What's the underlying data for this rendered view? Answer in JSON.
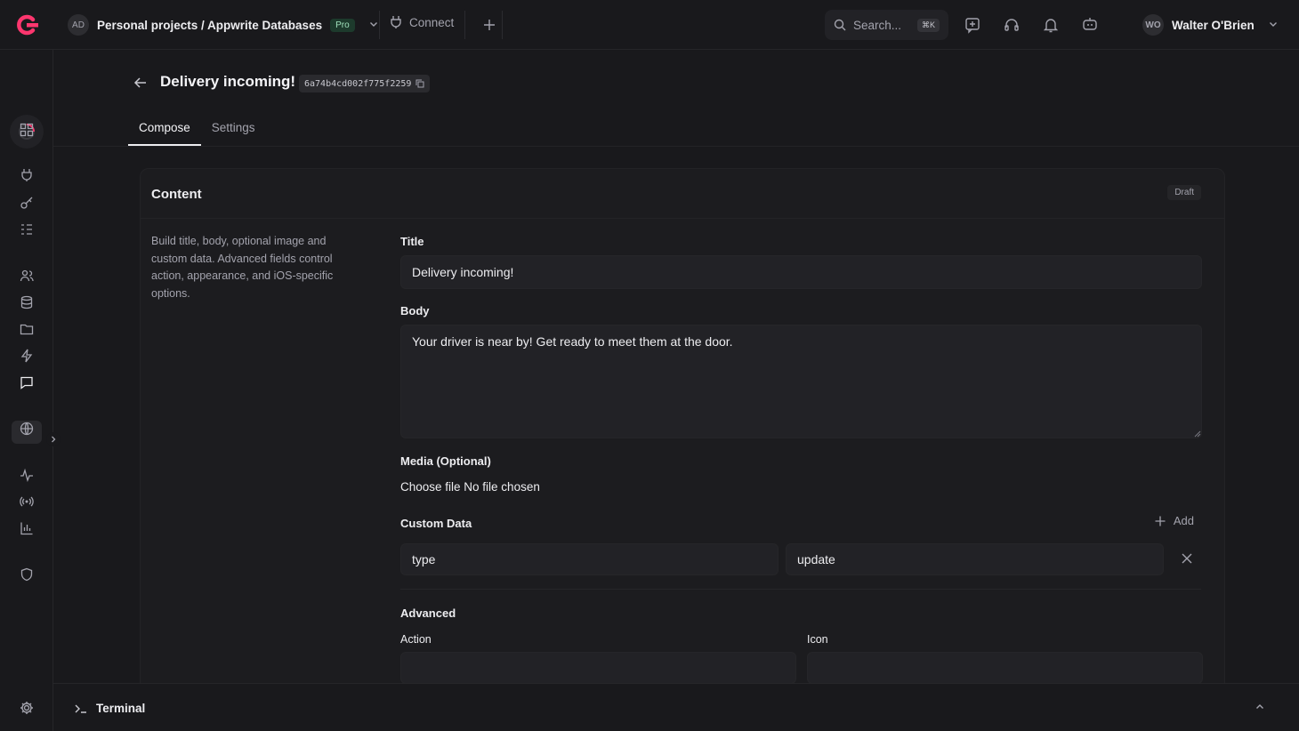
{
  "topbar": {
    "project_initials": "AD",
    "project_path": "Personal projects / Appwrite Databases",
    "plan_badge": "Pro",
    "connect_label": "Connect",
    "search_placeholder": "Search...",
    "search_shortcut": "⌘K",
    "user_initials": "WO",
    "user_name": "Walter O'Brien"
  },
  "page": {
    "title": "Delivery incoming!",
    "message_id": "6a74b4cd002f775f2259",
    "tabs": [
      {
        "label": "Compose",
        "active": true
      },
      {
        "label": "Settings",
        "active": false
      }
    ]
  },
  "card": {
    "title": "Content",
    "status_badge": "Draft",
    "description": "Build title, body, optional image and custom data. Advanced fields control action, appearance, and iOS-specific options.",
    "fields": {
      "title_label": "Title",
      "title_value": "Delivery incoming!",
      "body_label": "Body",
      "body_value": "Your driver is near by! Get ready to meet them at the door.",
      "media_label": "Media (Optional)",
      "media_file_text": "Choose file No file chosen",
      "custom_data_label": "Custom Data",
      "add_label": "Add",
      "custom_data": [
        {
          "key": "type",
          "value": "update"
        }
      ],
      "advanced_label": "Advanced",
      "action_label": "Action",
      "action_value": "",
      "icon_label": "Icon",
      "icon_value": ""
    }
  },
  "terminal": {
    "label": "Terminal"
  },
  "colors": {
    "background": "#19191c",
    "surface": "#1c1c1f",
    "input": "#222226",
    "brand": "#fd366e",
    "pro_badge": "#9fe0bb"
  }
}
